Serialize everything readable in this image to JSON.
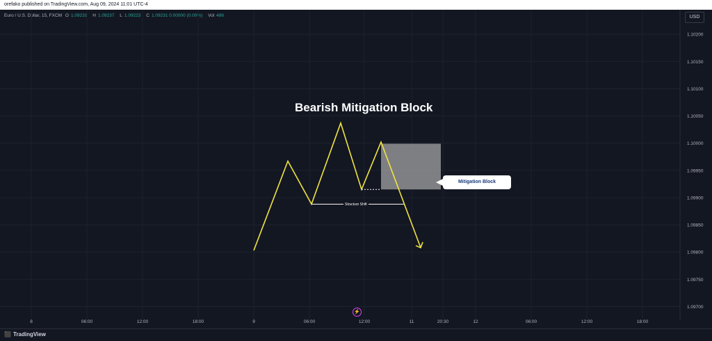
{
  "header": {
    "published_text": "orefako published on TradingView.com, Aug 09, 2024 11:01 UTC-4"
  },
  "legend": {
    "symbol": "Euro / U.S. Dollar, 15, FXCM",
    "o_label": "O",
    "o_value": "1.09231",
    "h_label": "H",
    "h_value": "1.09237",
    "l_label": "L",
    "l_value": "1.09223",
    "c_label": "C",
    "c_value": "1.09231 0.00000 (0.00%)",
    "vol_label": "Vol",
    "vol_value": "486"
  },
  "currency_button": "USD",
  "footer": {
    "brand": "TradingView"
  },
  "icons": {
    "brand": "tradingview-logo-icon",
    "replay": "lightning-bolt-icon"
  },
  "colors": {
    "background": "#131722",
    "zigzag": "#f0e442",
    "block": "#a8a8a8",
    "text": "#ffffff",
    "callout_text": "#1a3a7a"
  },
  "chart_data": {
    "type": "line",
    "title": "Bearish Mitigation Block",
    "annotations": {
      "structure_shift": "Structure Shift",
      "mitigation_block": "Mitigation Block"
    },
    "y_ticks": [
      "1.10200",
      "1.10150",
      "1.10100",
      "1.10050",
      "1.10000",
      "1.09950",
      "1.09900",
      "1.09850",
      "1.09800",
      "1.09750",
      "1.09700"
    ],
    "y_values": [
      1.102,
      1.1015,
      1.101,
      1.1005,
      1.1,
      1.0995,
      1.099,
      1.0985,
      1.098,
      1.0975,
      1.097
    ],
    "ylim": [
      1.09675,
      1.10245
    ],
    "x_ticks": [
      "8",
      "06:00",
      "12:00",
      "18:00",
      "9",
      "06:00",
      "12:00",
      "11",
      "20:30",
      "12",
      "06:00",
      "12:00",
      "18:00"
    ],
    "series": [
      {
        "points": [
          {
            "t": 0,
            "y": 1.09803
          },
          {
            "t": 1,
            "y": 1.09967
          },
          {
            "t": 2,
            "y": 1.09888
          },
          {
            "t": 3,
            "y": 1.10037
          },
          {
            "t": 4,
            "y": 1.09915
          },
          {
            "t": 5,
            "y": 1.10002
          },
          {
            "t": 6,
            "y": 1.09808
          }
        ]
      }
    ],
    "mitigation_block_range": {
      "low": 1.09915,
      "high": 1.09999
    },
    "grid": true
  }
}
